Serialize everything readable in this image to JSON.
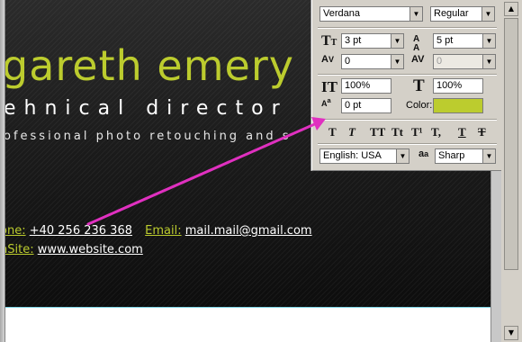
{
  "canvas": {
    "name": "gareth emery",
    "job_title": "ehnical director",
    "tagline": "ofessional photo retouching and s",
    "contacts": [
      {
        "label": "one:",
        "value": "+40 256 236 368"
      },
      {
        "label": "Email:",
        "value": "mail.mail@gmail.com"
      },
      {
        "label": "nSite:",
        "value": "www.website.com"
      }
    ]
  },
  "character_panel": {
    "font_family": "Verdana",
    "font_style": "Regular",
    "font_size": "3 pt",
    "leading": "5 pt",
    "kerning": "0",
    "tracking": "0",
    "vertical_scale": "100%",
    "horizontal_scale": "100%",
    "baseline_shift": "0 pt",
    "color_label": "Color:",
    "language": "English: USA",
    "antialias_label": "a",
    "antialias": "Sharp",
    "style_buttons": [
      "T",
      "T",
      "TT",
      "Tt",
      "T¹",
      "T,",
      "T",
      "T"
    ]
  },
  "colors": {
    "accent_green": "#bccc2e",
    "arrow_magenta": "#e030c0",
    "text_color_swatch": "#bccc2e"
  },
  "icons": {
    "arrow": "arrow-annotation",
    "dropdown": "chevron-down-icon"
  }
}
